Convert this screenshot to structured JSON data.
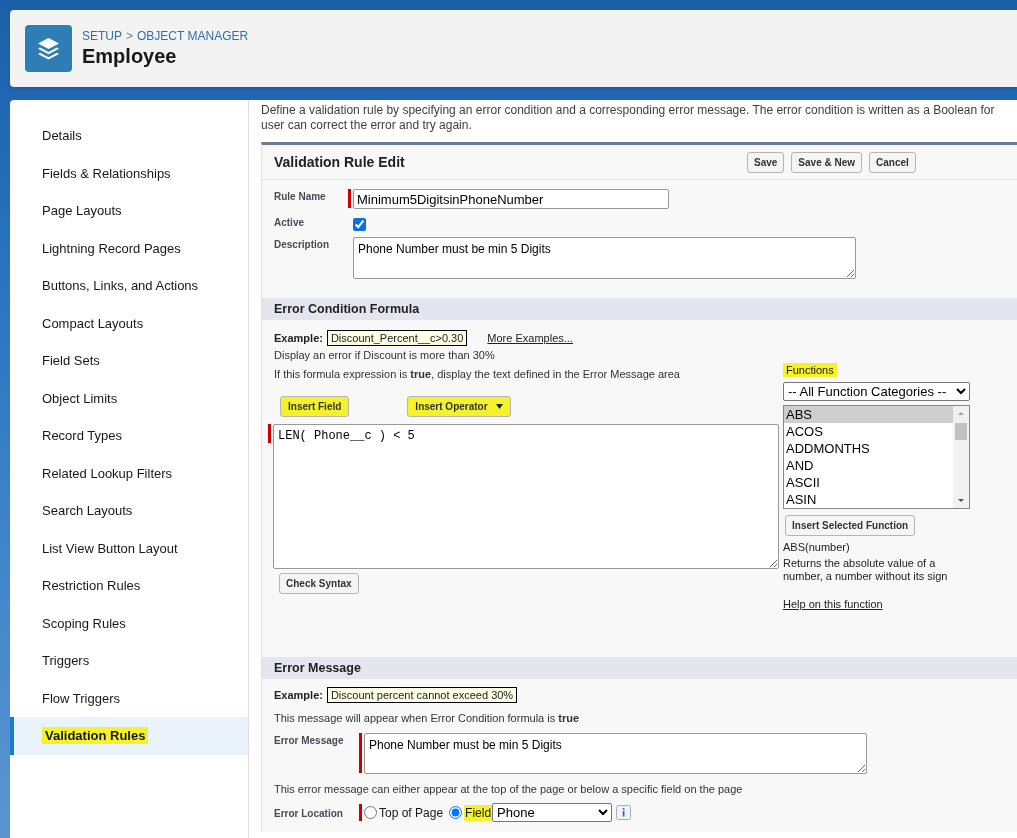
{
  "header": {
    "breadcrumb": [
      "SETUP",
      "OBJECT MANAGER"
    ],
    "separator": ">",
    "title": "Employee"
  },
  "sidebar": {
    "items": [
      {
        "label": "Details",
        "selected": false,
        "highlighted": false
      },
      {
        "label": "Fields & Relationships",
        "selected": false,
        "highlighted": false
      },
      {
        "label": "Page Layouts",
        "selected": false,
        "highlighted": false
      },
      {
        "label": "Lightning Record Pages",
        "selected": false,
        "highlighted": false
      },
      {
        "label": "Buttons, Links, and Actions",
        "selected": false,
        "highlighted": false
      },
      {
        "label": "Compact Layouts",
        "selected": false,
        "highlighted": false
      },
      {
        "label": "Field Sets",
        "selected": false,
        "highlighted": false
      },
      {
        "label": "Object Limits",
        "selected": false,
        "highlighted": false
      },
      {
        "label": "Record Types",
        "selected": false,
        "highlighted": false
      },
      {
        "label": "Related Lookup Filters",
        "selected": false,
        "highlighted": false
      },
      {
        "label": "Search Layouts",
        "selected": false,
        "highlighted": false
      },
      {
        "label": "List View Button Layout",
        "selected": false,
        "highlighted": false
      },
      {
        "label": "Restriction Rules",
        "selected": false,
        "highlighted": false
      },
      {
        "label": "Scoping Rules",
        "selected": false,
        "highlighted": false
      },
      {
        "label": "Triggers",
        "selected": false,
        "highlighted": false
      },
      {
        "label": "Flow Triggers",
        "selected": false,
        "highlighted": false
      },
      {
        "label": "Validation Rules",
        "selected": true,
        "highlighted": true
      }
    ]
  },
  "intro": [
    "Define a validation rule by specifying an error condition and a corresponding error message. The error condition is written as a Boolean for",
    "user can correct the error and try again."
  ],
  "panel": {
    "title": "Validation Rule Edit",
    "buttons": [
      "Save",
      "Save & New",
      "Cancel"
    ],
    "rule_name": {
      "label": "Rule Name",
      "value": "Minimum5DigitsinPhoneNumber",
      "required": true
    },
    "active": {
      "label": "Active",
      "checked": true
    },
    "description": {
      "label": "Description",
      "value": "Phone Number must be min 5 Digits"
    }
  },
  "formula_section": {
    "title": "Error Condition Formula",
    "example_label": "Example:",
    "example_value": "Discount_Percent__c>0.30",
    "more_examples": "More Examples...",
    "hint": "Display an error if Discount is more than 30%",
    "note": "If this formula expression is **true**, display the text defined in the Error Message area",
    "insert_field": {
      "label": "Insert Field",
      "highlighted": true
    },
    "insert_operator": {
      "label": "Insert Operator",
      "highlighted": true
    },
    "formula": {
      "value": "LEN( Phone__c ) < 5",
      "required": true
    },
    "check_syntax": "Check Syntax",
    "functions": {
      "label": "Functions",
      "highlighted": true,
      "category": "-- All Function Categories --",
      "items": [
        {
          "label": "ABS",
          "selected": true
        },
        {
          "label": "ACOS",
          "selected": false
        },
        {
          "label": "ADDMONTHS",
          "selected": false
        },
        {
          "label": "AND",
          "selected": false
        },
        {
          "label": "ASCII",
          "selected": false
        },
        {
          "label": "ASIN",
          "selected": false
        }
      ],
      "insert_button": "Insert Selected Function",
      "signature": "ABS(number)",
      "description": "Returns the absolute value of a number, a number without its sign",
      "help": "Help on this function"
    }
  },
  "error_section": {
    "title": "Error Message",
    "example_label": "Example:",
    "example_value": "Discount percent cannot exceed 30%",
    "note": "This message will appear when Error Condition formula is **true**",
    "error_message": {
      "label": "Error Message",
      "value": "Phone Number must be min 5 Digits",
      "required": true
    },
    "location_note": "This error message can either appear at the top of the page or below a specific field on the page",
    "location": {
      "label": "Error Location",
      "required": true,
      "options": [
        {
          "label": "Top of Page",
          "selected": false,
          "highlighted": false
        },
        {
          "label": "Field",
          "selected": true,
          "highlighted": true
        }
      ],
      "field": "Phone"
    }
  }
}
